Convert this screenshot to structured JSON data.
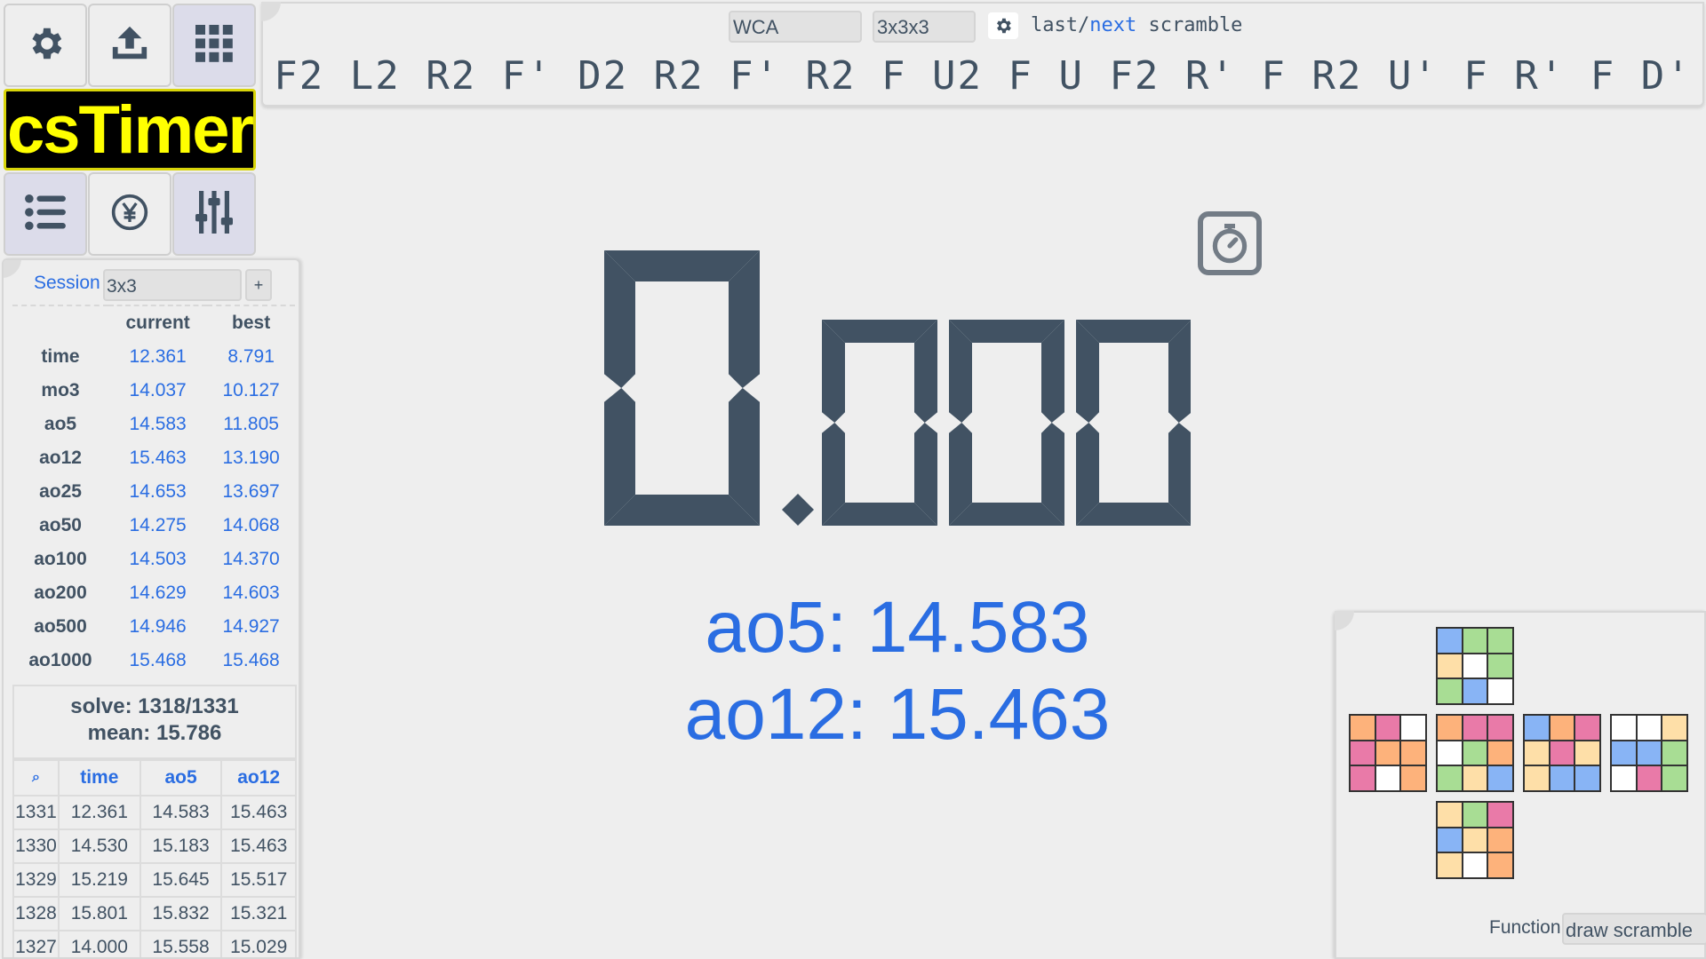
{
  "colors": {
    "text": "#415263",
    "accent_blue": "#2a6de2",
    "logo_bg": "#000000",
    "logo_text": "#ffff00",
    "sticker_blue": "#88b4f5",
    "sticker_green": "#a8dd94",
    "sticker_yellow": "#fedfa8",
    "sticker_white": "#ffffff",
    "sticker_pink": "#e97aa8",
    "sticker_orange": "#fdb27b"
  },
  "toolbar": {
    "icons": [
      "gear-icon",
      "export-icon",
      "grid-icon",
      "list-icon",
      "yen-coin-icon",
      "sliders-icon"
    ]
  },
  "logo": {
    "text": "csTimer"
  },
  "scramble": {
    "type_select": "WCA",
    "puzzle_select": "3x3x3",
    "last_label": "last",
    "slash": "/",
    "next_label": "next",
    "scramble_word": "scramble",
    "text": "F2 L2 R2 F' D2 R2 F' R2 F U2 F U F2 R' F R2 U' F R' F D'"
  },
  "session": {
    "label": "Session",
    "value": "3x3",
    "add_label": "+"
  },
  "summary": {
    "headers": [
      "current",
      "best"
    ],
    "rows": [
      {
        "label": "time",
        "current": "12.361",
        "best": "8.791"
      },
      {
        "label": "mo3",
        "current": "14.037",
        "best": "10.127"
      },
      {
        "label": "ao5",
        "current": "14.583",
        "best": "11.805"
      },
      {
        "label": "ao12",
        "current": "15.463",
        "best": "13.190"
      },
      {
        "label": "ao25",
        "current": "14.653",
        "best": "13.697"
      },
      {
        "label": "ao50",
        "current": "14.275",
        "best": "14.068"
      },
      {
        "label": "ao100",
        "current": "14.503",
        "best": "14.370"
      },
      {
        "label": "ao200",
        "current": "14.629",
        "best": "14.603"
      },
      {
        "label": "ao500",
        "current": "14.946",
        "best": "14.927"
      },
      {
        "label": "ao1000",
        "current": "15.468",
        "best": "15.468"
      }
    ],
    "solve_text": "solve: 1318/1331",
    "mean_text": "mean: 15.786"
  },
  "solves": {
    "headers": [
      "⌕",
      "time",
      "ao5",
      "ao12"
    ],
    "rows": [
      [
        "1331",
        "12.361",
        "14.583",
        "15.463"
      ],
      [
        "1330",
        "14.530",
        "15.183",
        "15.463"
      ],
      [
        "1329",
        "15.219",
        "15.645",
        "15.517"
      ],
      [
        "1328",
        "15.801",
        "15.832",
        "15.321"
      ],
      [
        "1327",
        "14.000",
        "15.558",
        "15.029"
      ]
    ]
  },
  "timer": {
    "display": "0.000",
    "stats_lines": [
      "ao5: 14.583",
      "ao12: 15.463"
    ]
  },
  "tool": {
    "function_label": "Function",
    "function_value": "draw scramble",
    "faces": {
      "U": [
        "blue",
        "green",
        "green",
        "yellow",
        "white",
        "green",
        "green",
        "blue",
        "white"
      ],
      "L": [
        "orange",
        "pink",
        "white",
        "pink",
        "orange",
        "orange",
        "pink",
        "white",
        "orange"
      ],
      "F": [
        "orange",
        "pink",
        "pink",
        "white",
        "green",
        "orange",
        "green",
        "yellow",
        "blue"
      ],
      "R": [
        "blue",
        "orange",
        "pink",
        "yellow",
        "pink",
        "yellow",
        "yellow",
        "blue",
        "blue"
      ],
      "B": [
        "white",
        "white",
        "yellow",
        "blue",
        "blue",
        "green",
        "white",
        "pink",
        "green"
      ],
      "D": [
        "yellow",
        "green",
        "pink",
        "blue",
        "yellow",
        "orange",
        "yellow",
        "white",
        "orange"
      ]
    }
  }
}
